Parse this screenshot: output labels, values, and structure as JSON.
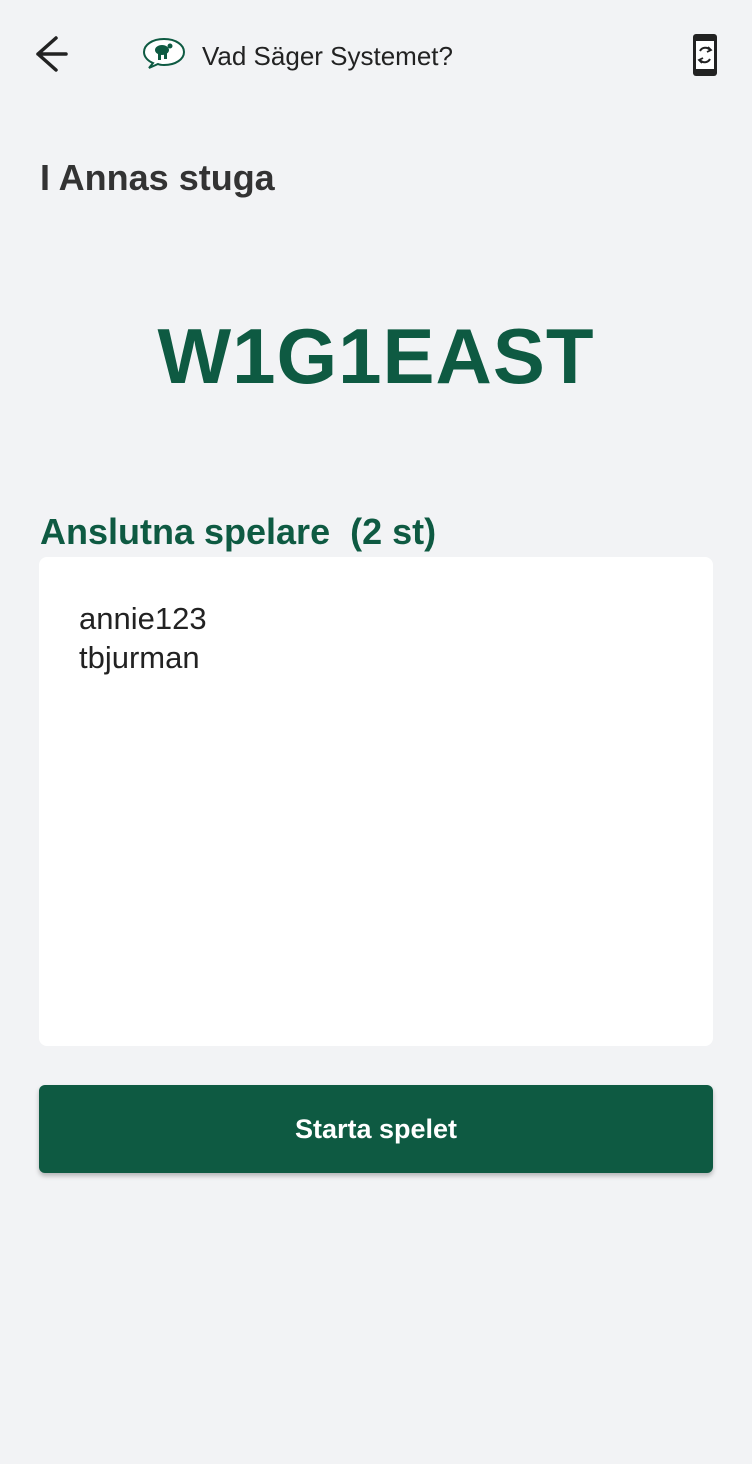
{
  "header": {
    "back_icon": "arrow-left-icon",
    "logo_icon": "speech-bubble-bottle-logo",
    "title": "Vad Säger Systemet?",
    "device_icon": "phone-rotate-icon"
  },
  "room": {
    "name": "I Annas stuga",
    "code": "W1G1EAST"
  },
  "players": {
    "heading": "Anslutna spelare  (2 st)",
    "list": [
      "annie123",
      "tbjurman"
    ]
  },
  "actions": {
    "start_label": "Starta spelet"
  },
  "colors": {
    "brand_green": "#0e5a42",
    "background": "#f2f3f5",
    "card": "#ffffff"
  }
}
